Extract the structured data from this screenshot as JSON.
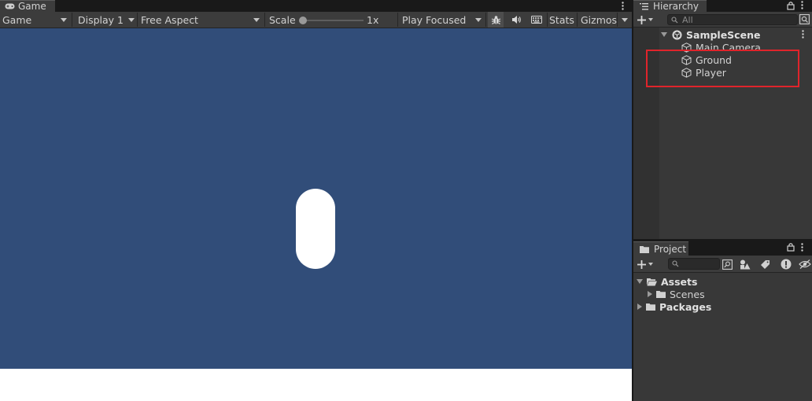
{
  "game": {
    "tab_label": "Game",
    "toolbar": {
      "mode": "Game",
      "display": "Display 1",
      "aspect": "Free Aspect",
      "scale_label": "Scale",
      "scale_value": "1x",
      "scale_slider_fraction": 0,
      "play_mode": "Play Focused",
      "stats_label": "Stats",
      "gizmos_label": "Gizmos"
    },
    "view_background": "#314d79",
    "player_color": "#ffffff"
  },
  "hierarchy": {
    "tab_label": "Hierarchy",
    "search_placeholder": "All",
    "scene_name": "SampleScene",
    "objects": [
      "Main Camera",
      "Ground",
      "Player"
    ]
  },
  "project": {
    "tab_label": "Project",
    "search_placeholder": "",
    "tree": [
      {
        "label": "Assets",
        "expanded": true,
        "bold": true
      },
      {
        "label": "Scenes",
        "expanded": false,
        "bold": false
      },
      {
        "label": "Packages",
        "expanded": false,
        "bold": true
      }
    ]
  },
  "colors": {
    "highlight_box": "#e0242b",
    "panel_bg": "#383838",
    "toolbar_bg": "#3c3c3c"
  }
}
